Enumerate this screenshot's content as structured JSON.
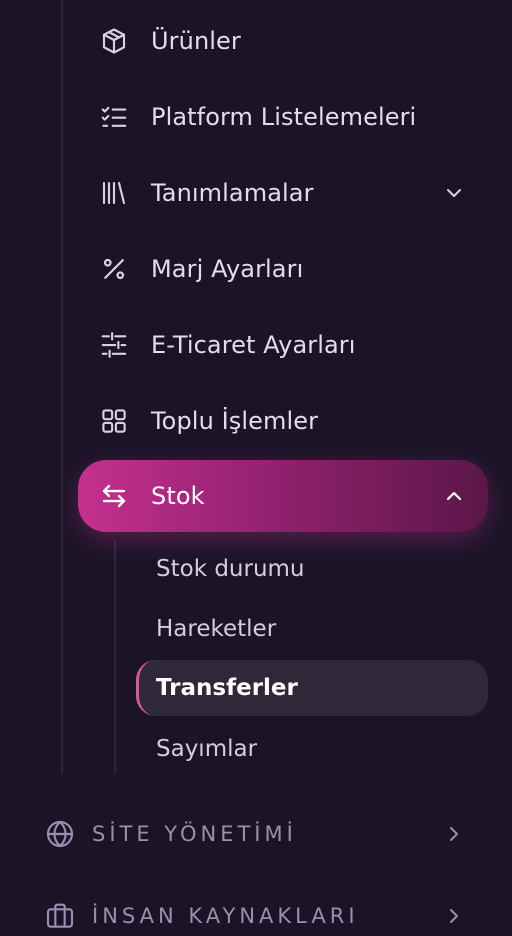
{
  "colors": {
    "background": "#1b1427",
    "active_gradient_start": "#c4308f",
    "active_gradient_end": "#5a1748",
    "active_sub_bg": "#2f2839",
    "active_sub_accent": "#e0559f",
    "text": "#e2dcec",
    "section_text": "#9a8fb0"
  },
  "nav": {
    "items": [
      {
        "label": "Ürünler",
        "icon": "box-icon"
      },
      {
        "label": "Platform Listelemeleri",
        "icon": "checklist-icon"
      },
      {
        "label": "Tanımlamalar",
        "icon": "library-icon",
        "expandable": true,
        "expanded": false
      },
      {
        "label": "Marj Ayarları",
        "icon": "percent-icon"
      },
      {
        "label": "E-Ticaret Ayarları",
        "icon": "sliders-icon"
      },
      {
        "label": "Toplu İşlemler",
        "icon": "grid-icon"
      },
      {
        "label": "Stok",
        "icon": "arrows-exchange-icon",
        "expandable": true,
        "expanded": true,
        "active": true
      }
    ],
    "stock_sub_items": [
      {
        "label": "Stok durumu"
      },
      {
        "label": "Hareketler"
      },
      {
        "label": "Transferler",
        "active": true
      },
      {
        "label": "Sayımlar"
      }
    ]
  },
  "sections": [
    {
      "label": "SİTE YÖNETİMİ",
      "icon": "globe-icon"
    },
    {
      "label": "İNSAN KAYNAKLARI",
      "icon": "briefcase-icon"
    }
  ]
}
